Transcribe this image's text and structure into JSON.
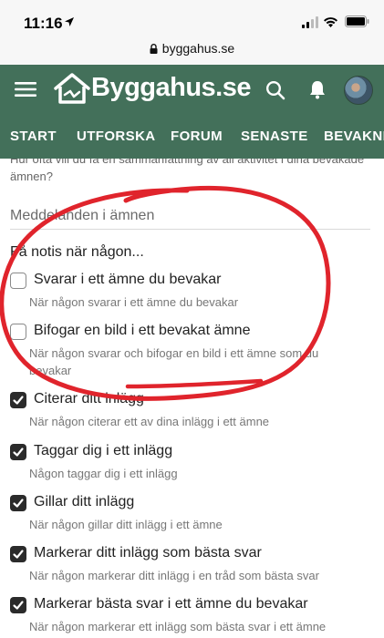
{
  "status_bar": {
    "time": "11:16"
  },
  "browser": {
    "url": "byggahus.se"
  },
  "header": {
    "logo_text": "Byggahus.se"
  },
  "nav": {
    "items": [
      "START",
      "UTFORSKA",
      "FORUM",
      "SENASTE",
      "BEVAKNINGAR"
    ]
  },
  "intro": {
    "text": "Hur ofta vill du få en sammanfattning av all aktivitet i dina bevakade ämnen?"
  },
  "section": {
    "title": "Meddelanden i ämnen",
    "notify_label": "Få notis när någon..."
  },
  "options": [
    {
      "label": "Svarar i ett ämne du bevakar",
      "desc": "När någon svarar i ett ämne du bevakar",
      "checked": false
    },
    {
      "label": "Bifogar en bild i ett bevakat ämne",
      "desc": "När någon svarar och bifogar en bild i ett ämne som du bevakar",
      "checked": false
    },
    {
      "label": "Citerar ditt inlägg",
      "desc": "När någon citerar ett av dina inlägg i ett ämne",
      "checked": true
    },
    {
      "label": "Taggar dig i ett inlägg",
      "desc": "Någon taggar dig i ett inlägg",
      "checked": true
    },
    {
      "label": "Gillar ditt inlägg",
      "desc": "När någon gillar ditt inlägg i ett ämne",
      "checked": true
    },
    {
      "label": "Markerar ditt inlägg som bästa svar",
      "desc": "När någon markerar ditt inlägg i en tråd som bästa svar",
      "checked": true
    },
    {
      "label": "Markerar bästa svar i ett ämne du bevakar",
      "desc": "När någon markerar ett inlägg som bästa svar i ett ämne",
      "checked": true
    }
  ],
  "colors": {
    "header_bg": "#43705a",
    "annotation": "#e0242c",
    "checkbox_checked": "#2b2b2b"
  },
  "icons": [
    "location-arrow-icon",
    "signal-icon",
    "wifi-icon",
    "battery-icon",
    "lock-icon",
    "menu-icon",
    "logo-house-icon",
    "search-icon",
    "bell-icon"
  ]
}
